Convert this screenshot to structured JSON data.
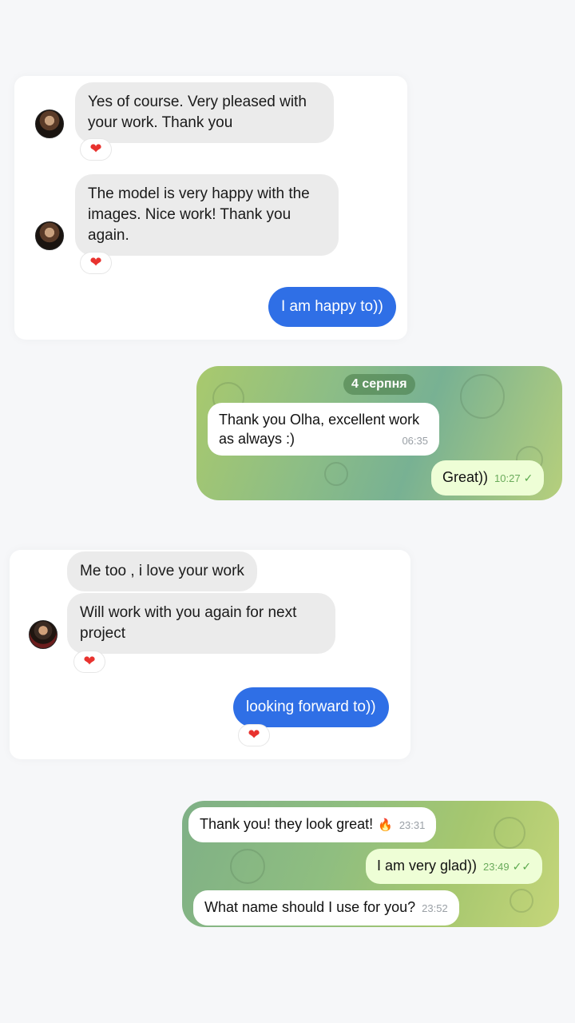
{
  "conv1": {
    "messages": [
      {
        "text": "Yes of course. Very pleased with your work. Thank you",
        "reaction": "❤"
      },
      {
        "text": "The model is very happy with the images. Nice work! Thank you again.",
        "reaction": "❤"
      }
    ],
    "reply": "I am happy to))"
  },
  "tg1": {
    "date": "4 серпня",
    "incoming": {
      "text": "Thank you Olha, excellent work as always :)",
      "time": "06:35"
    },
    "outgoing": {
      "text": "Great))",
      "time": "10:27",
      "status": "✓"
    }
  },
  "conv2": {
    "messages": [
      {
        "text": "Me too , i love your work"
      },
      {
        "text": "Will work with you again for next project",
        "reaction": "❤"
      }
    ],
    "reply": "looking forward to))",
    "reply_reaction": "❤"
  },
  "tg2": {
    "incoming1": {
      "text": "Thank you! they look great!",
      "reaction": "🔥",
      "time": "23:31"
    },
    "outgoing": {
      "text": "I am very glad))",
      "time": "23:49",
      "status": "✓✓"
    },
    "incoming2": {
      "text": "What name should I use for you?",
      "time": "23:52"
    }
  },
  "colors": {
    "blue_bubble": "#2f6fe6",
    "gray_bubble": "#ebebeb",
    "heart": "#e8322e",
    "tg_out_bubble": "#eefed6"
  }
}
